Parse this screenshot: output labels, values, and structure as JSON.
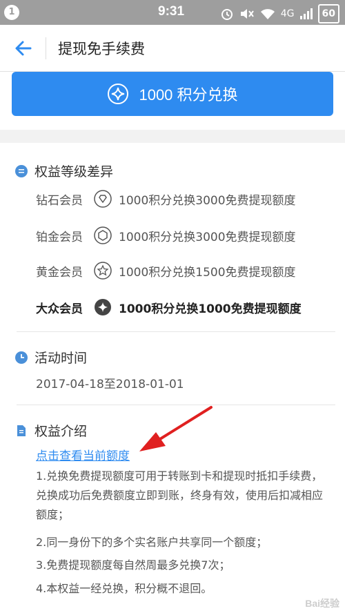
{
  "status_bar": {
    "notification_count": "1",
    "time": "9:31",
    "battery": "60",
    "signal_text": "4G"
  },
  "app_bar": {
    "title": "提现免手续费"
  },
  "exchange": {
    "label": "1000 积分兑换"
  },
  "tier_section": {
    "title": "权益等级差异",
    "tiers": [
      {
        "name": "钻石会员",
        "desc": "1000积分兑换3000免费提现额度",
        "icon": "diamond-icon"
      },
      {
        "name": "铂金会员",
        "desc": "1000积分兑换3000免费提现额度",
        "icon": "hexagon-icon"
      },
      {
        "name": "黄金会员",
        "desc": "1000积分兑换1500免费提现额度",
        "icon": "star-icon"
      },
      {
        "name": "大众会员",
        "desc": "1000积分兑换1000免费提现额度",
        "icon": "sparkle-icon"
      }
    ]
  },
  "time_section": {
    "title": "活动时间",
    "range": "2017-04-18至2018-01-01"
  },
  "intro_section": {
    "title": "权益介绍",
    "link": "点击查看当前额度",
    "items": [
      "1.兑换免费提现额度可用于转账到卡和提现时抵扣手续费，兑换成功后免费额度立即到账，终身有效，使用后扣减相应额度；",
      "2.同一身份下的多个实名账户共享同一个额度；",
      "3.免费提现额度每自然周最多兑换7次；",
      "4.本权益一经兑换，积分概不退回。"
    ]
  },
  "watermark": "Bai经验",
  "colors": {
    "accent": "#2e8bf0",
    "status_bar": "#9e9e9e",
    "arrow": "#e02020"
  }
}
